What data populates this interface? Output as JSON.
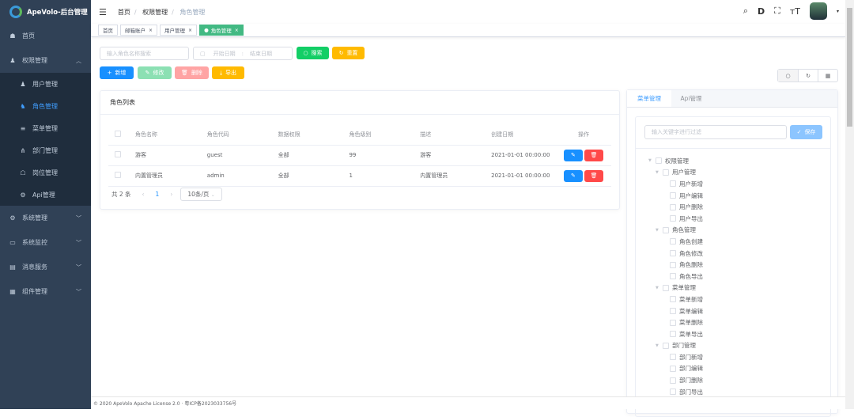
{
  "app": {
    "title": "ApeVolo-后台管理"
  },
  "sidebar": {
    "items": [
      {
        "label": "首页",
        "icon": "dashboard-icon"
      },
      {
        "label": "权限管理",
        "icon": "user-icon",
        "expanded": true,
        "children": [
          {
            "label": "用户管理",
            "icon": "user-icon"
          },
          {
            "label": "角色管理",
            "icon": "role-icon",
            "active": true
          },
          {
            "label": "菜单管理",
            "icon": "menu-icon"
          },
          {
            "label": "部门管理",
            "icon": "tree-icon"
          },
          {
            "label": "岗位管理",
            "icon": "post-icon"
          },
          {
            "label": "Api管理",
            "icon": "api-icon"
          }
        ]
      },
      {
        "label": "系统管理",
        "icon": "gear-icon"
      },
      {
        "label": "系统监控",
        "icon": "monitor-icon"
      },
      {
        "label": "消息服务",
        "icon": "message-icon"
      },
      {
        "label": "组件管理",
        "icon": "grid-icon"
      }
    ]
  },
  "breadcrumb": [
    "首页",
    "权限管理",
    "角色管理"
  ],
  "tags": [
    {
      "label": "首页"
    },
    {
      "label": "邮箱账户",
      "closable": true
    },
    {
      "label": "用户管理",
      "closable": true
    },
    {
      "label": "角色管理",
      "closable": true,
      "active": true
    }
  ],
  "filters": {
    "name_placeholder": "输入角色名称搜索",
    "start_placeholder": "开始日期",
    "sep": ":",
    "end_placeholder": "结束日期",
    "search": "搜索",
    "reset": "重置"
  },
  "toolbar": {
    "add": "新增",
    "edit": "修改",
    "delete": "删除",
    "export": "导出"
  },
  "colors": {
    "primary": "#1890ff",
    "success": "#13ce66",
    "warning": "#ffba00",
    "danger": "#ff4949",
    "sidebar": "#304156"
  },
  "table": {
    "title": "角色列表",
    "columns": [
      "角色名称",
      "角色代码",
      "数据权限",
      "角色级别",
      "描述",
      "创建日期",
      "操作"
    ],
    "rows": [
      [
        "游客",
        "guest",
        "全部",
        "99",
        "游客",
        "2021-01-01 00:00:00"
      ],
      [
        "内置管理员",
        "admin",
        "全部",
        "1",
        "内置管理员",
        "2021-01-01 00:00:00"
      ]
    ],
    "total": "共 2 条",
    "page": "1",
    "page_size": "10条/页"
  },
  "right": {
    "tabs": [
      "菜单管理",
      "Api管理"
    ],
    "filter_placeholder": "输入关键字进行过滤",
    "save": "保存",
    "tree": [
      [
        "权限管理",
        0
      ],
      [
        "用户管理",
        1
      ],
      [
        "用户新增",
        2
      ],
      [
        "用户编辑",
        2
      ],
      [
        "用户删除",
        2
      ],
      [
        "用户导出",
        2
      ],
      [
        "角色管理",
        1
      ],
      [
        "角色创建",
        2
      ],
      [
        "角色修改",
        2
      ],
      [
        "角色删除",
        2
      ],
      [
        "角色导出",
        2
      ],
      [
        "菜单管理",
        1
      ],
      [
        "菜单新增",
        2
      ],
      [
        "菜单编辑",
        2
      ],
      [
        "菜单删除",
        2
      ],
      [
        "菜单导出",
        2
      ],
      [
        "部门管理",
        1
      ],
      [
        "部门新增",
        2
      ],
      [
        "部门编辑",
        2
      ],
      [
        "部门删除",
        2
      ],
      [
        "部门导出",
        2
      ]
    ]
  },
  "footer": "© 2020 ApeVolo Apache License 2.0 · 粤ICP备2023033756号"
}
